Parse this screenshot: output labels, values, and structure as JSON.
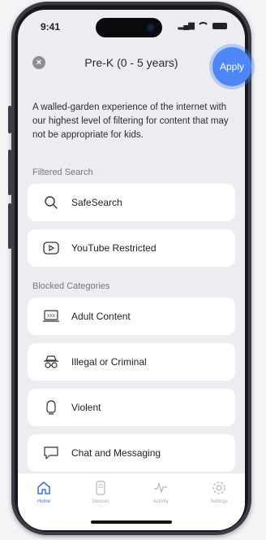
{
  "status_bar": {
    "time": "9:41"
  },
  "header": {
    "title": "Pre-K (0 - 5 years)",
    "apply_label": "Apply",
    "close_glyph": "×"
  },
  "description": "A walled-garden experience of the internet with our highest level of filtering for content that may not be appropriate for kids.",
  "filtered_search": {
    "label": "Filtered Search",
    "items": [
      {
        "label": "SafeSearch",
        "icon": "search-icon"
      },
      {
        "label": "YouTube Restricted",
        "icon": "play-icon"
      }
    ]
  },
  "blocked_categories": {
    "label": "Blocked Categories",
    "items": [
      {
        "label": "Adult Content",
        "icon": "xxx-laptop-icon"
      },
      {
        "label": "Illegal or Criminal",
        "icon": "disguise-icon"
      },
      {
        "label": "Violent",
        "icon": "fist-icon"
      },
      {
        "label": "Chat and Messaging",
        "icon": "chat-bubble-icon"
      }
    ]
  },
  "tab_bar": {
    "tabs": [
      {
        "label": "Home",
        "icon": "home-icon",
        "active": true
      },
      {
        "label": "Devices",
        "icon": "devices-icon",
        "active": false
      },
      {
        "label": "Activity",
        "icon": "activity-icon",
        "active": false
      },
      {
        "label": "Settings",
        "icon": "gear-icon",
        "active": false
      }
    ]
  },
  "colors": {
    "accent": "#4e86f5",
    "active_tab": "#3d6fe0",
    "screen_bg": "#ededf1"
  }
}
